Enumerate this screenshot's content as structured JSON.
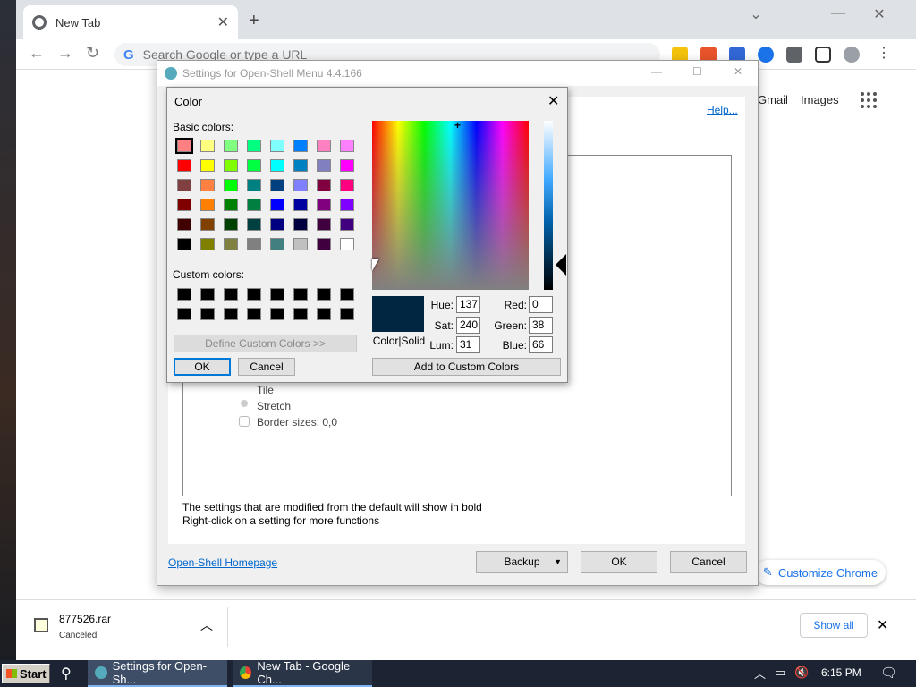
{
  "browser": {
    "tab_title": "New Tab",
    "new_tab_glyph": "+",
    "omnibox_placeholder": "Search Google or type a URL",
    "gmail_link": "Gmail",
    "images_link": "Images",
    "customize_label": "Customize Chrome",
    "download": {
      "filename": "877526.rar",
      "status": "Canceled",
      "show_all": "Show all"
    }
  },
  "settings_window": {
    "title": "Settings for Open-Shell Menu 4.4.166",
    "help_link": "Help...",
    "options": [
      "Tile",
      "Stretch",
      "Border sizes: 0,0"
    ],
    "footer_line1": "The settings that are modified from the default will show in bold",
    "footer_line2": "Right-click on a setting for more functions",
    "homepage_link": "Open-Shell Homepage",
    "backup_button": "Backup",
    "ok_button": "OK",
    "cancel_button": "Cancel"
  },
  "color_dialog": {
    "title": "Color",
    "basic_colors_label": "Basic colors:",
    "custom_colors_label": "Custom colors:",
    "define_custom_button": "Define Custom Colors >>",
    "ok_button": "OK",
    "cancel_button": "Cancel",
    "add_custom_button": "Add to Custom Colors",
    "color_solid_label": "Color|Solid",
    "hue_label": "Hue:",
    "hue": "137",
    "sat_label": "Sat:",
    "sat": "240",
    "lum_label": "Lum:",
    "lum": "31",
    "red_label": "Red:",
    "red": "0",
    "green_label": "Green:",
    "green": "38",
    "blue_label": "Blue:",
    "blue": "66",
    "selected_color": "#002642",
    "basic_colors": [
      "#ff8080",
      "#ffff80",
      "#80ff80",
      "#00ff80",
      "#80ffff",
      "#0080ff",
      "#ff80c0",
      "#ff80ff",
      "#ff0000",
      "#ffff00",
      "#80ff00",
      "#00ff40",
      "#00ffff",
      "#0080c0",
      "#8080c0",
      "#ff00ff",
      "#804040",
      "#ff8040",
      "#00ff00",
      "#008080",
      "#004080",
      "#8080ff",
      "#800040",
      "#ff0080",
      "#800000",
      "#ff8000",
      "#008000",
      "#008040",
      "#0000ff",
      "#0000a0",
      "#800080",
      "#8000ff",
      "#400000",
      "#804000",
      "#004000",
      "#004040",
      "#000080",
      "#000040",
      "#400040",
      "#400080",
      "#000000",
      "#808000",
      "#808040",
      "#808080",
      "#408080",
      "#c0c0c0",
      "#400040",
      "#ffffff"
    ]
  },
  "taskbar": {
    "start_label": "Start",
    "task1": "Settings for Open-Sh...",
    "task2": "New Tab - Google Ch...",
    "clock": "6:15 PM"
  }
}
